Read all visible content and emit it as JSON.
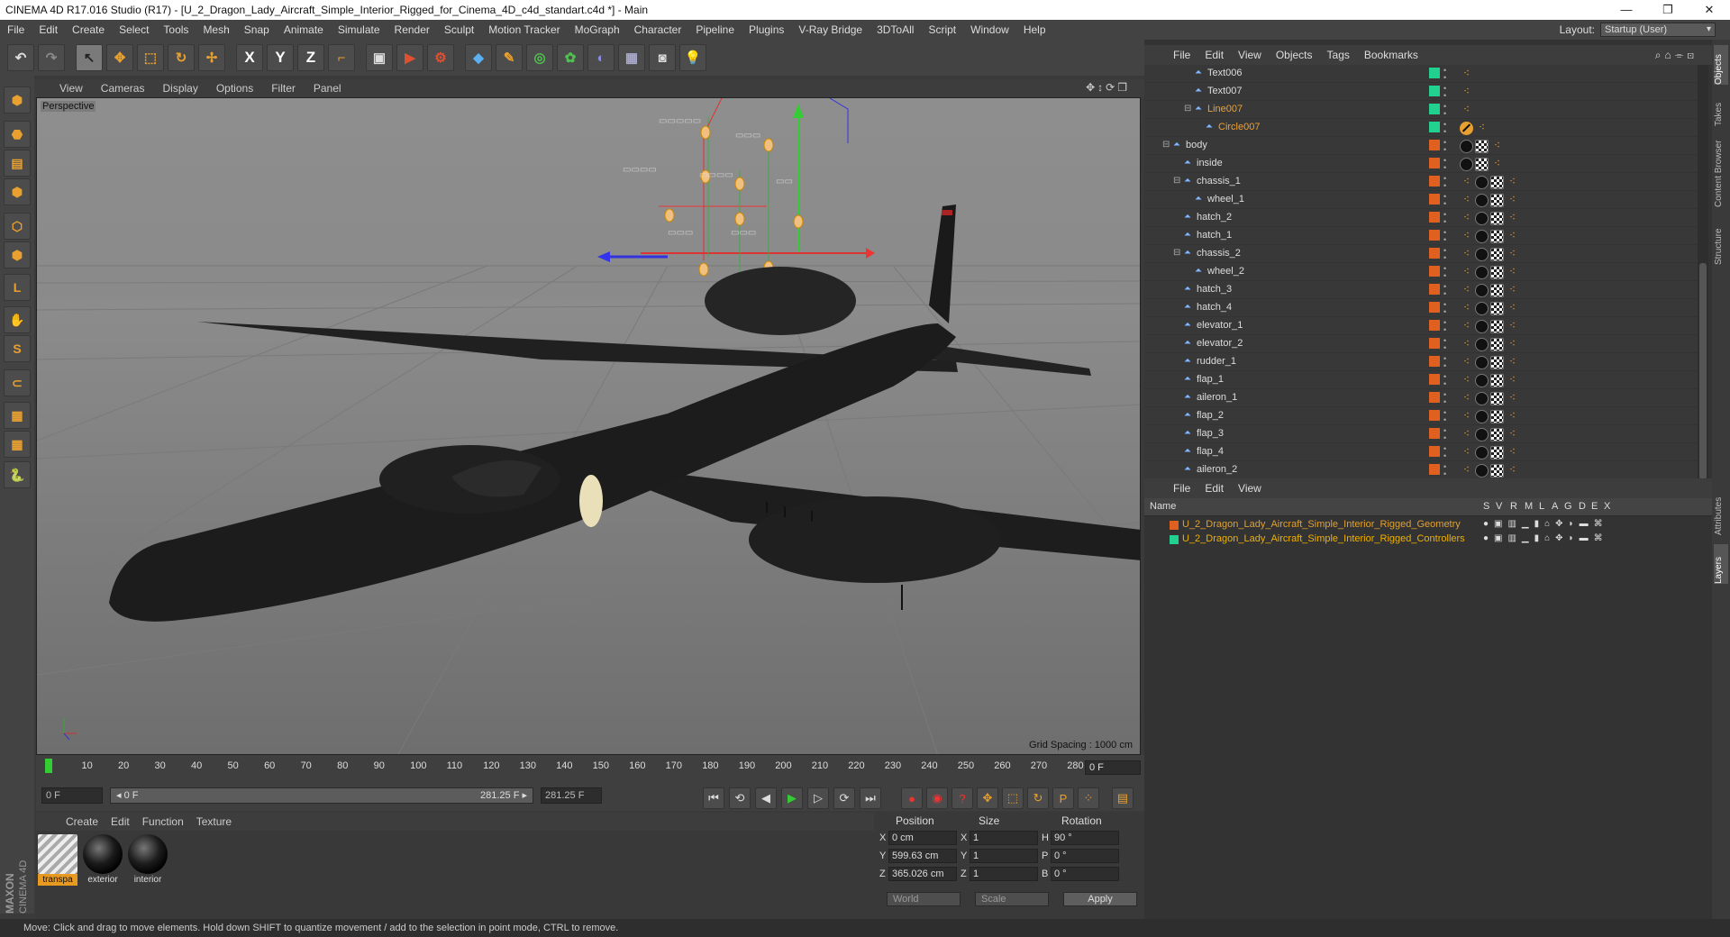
{
  "window": {
    "title": "CINEMA 4D R17.016 Studio (R17) - [U_2_Dragon_Lady_Aircraft_Simple_Interior_Rigged_for_Cinema_4D_c4d_standart.c4d *] - Main",
    "minimize": "—",
    "restore": "❐",
    "close": "✕"
  },
  "menu": [
    "File",
    "Edit",
    "Create",
    "Select",
    "Tools",
    "Mesh",
    "Snap",
    "Animate",
    "Simulate",
    "Render",
    "Sculpt",
    "Motion Tracker",
    "MoGraph",
    "Character",
    "Pipeline",
    "Plugins",
    "V-Ray Bridge",
    "3DToAll",
    "Script",
    "Window",
    "Help"
  ],
  "layout": {
    "label": "Layout:",
    "value": "Startup (User)"
  },
  "toolbar": {
    "undo": "↶",
    "redo": "↷",
    "pointer": "↖",
    "move": "✥",
    "scale": "⬚",
    "rotate": "↻",
    "transform": "✢",
    "x_axis": "X",
    "y_axis": "Y",
    "z_axis": "Z",
    "coord": "⌐",
    "render_view": "▣",
    "render_pv": "▶",
    "render_settings": "⚙",
    "cube": "◆",
    "spline": "✎",
    "nurbs": "◎",
    "array": "✿",
    "deformer": "◐",
    "floor": "▦",
    "camera": "◙",
    "light": "💡"
  },
  "lefttools": [
    "⬢",
    "⬣",
    "▤",
    "⬢",
    "⬡",
    "⬢",
    "L",
    "✋",
    "S",
    "⊂",
    "▦",
    "▦",
    "🐍"
  ],
  "viewport": {
    "menu": [
      "View",
      "Cameras",
      "Display",
      "Options",
      "Filter",
      "Panel"
    ],
    "nav": "✥↕⟳❐",
    "label": "Perspective",
    "grid_spacing": "Grid Spacing : 1000 cm"
  },
  "timeline": {
    "ticks": [
      "0",
      "10",
      "20",
      "30",
      "40",
      "50",
      "60",
      "70",
      "80",
      "90",
      "100",
      "110",
      "120",
      "130",
      "140",
      "150",
      "160",
      "170",
      "180",
      "190",
      "200",
      "210",
      "220",
      "230",
      "240",
      "250",
      "260",
      "270",
      "280"
    ],
    "current_frame": "0 F",
    "start": "0 F",
    "range_start": "◂ 0 F",
    "range_end": "281.25 F ▸",
    "end": "281.25 F",
    "buttons": [
      "⏮",
      "⟲",
      "◀",
      "▶",
      "▷",
      "⟳",
      "⏭"
    ],
    "rec_buttons": [
      "●",
      "◉",
      "?",
      "✥",
      "⬚",
      "↻",
      "P",
      "⁘",
      "▤"
    ]
  },
  "materials": {
    "menu": [
      "Create",
      "Edit",
      "Function",
      "Texture"
    ],
    "items": [
      {
        "name": "transpa",
        "color": "#d8d8d8"
      },
      {
        "name": "exterior",
        "color": "#1a1a1a"
      },
      {
        "name": "interior",
        "color": "#1d1d1d"
      }
    ]
  },
  "coords": {
    "headers": [
      "Position",
      "Size",
      "Rotation"
    ],
    "rows": [
      {
        "axis": "X",
        "pos": "0 cm",
        "sax": "X",
        "size": "1",
        "rax": "H",
        "rot": "90 °"
      },
      {
        "axis": "Y",
        "pos": "599.63 cm",
        "sax": "Y",
        "size": "1",
        "rax": "P",
        "rot": "0 °"
      },
      {
        "axis": "Z",
        "pos": "365.026 cm",
        "sax": "Z",
        "size": "1",
        "rax": "B",
        "rot": "0 °"
      }
    ],
    "mode": "World",
    "scale_mode": "Scale",
    "apply": "Apply"
  },
  "brand": {
    "line1": "MAXON",
    "line2": "CINEMA 4D"
  },
  "status": "Move: Click and drag to move elements. Hold down SHIFT to quantize movement / add to the selection in point mode, CTRL to remove.",
  "objects": {
    "menu": [
      "File",
      "Edit",
      "View",
      "Objects",
      "Tags",
      "Bookmarks"
    ],
    "icons": "⌕⌂⌯⊡",
    "rows": [
      {
        "name": "Text006",
        "indent": 3,
        "color": "#22d090",
        "orange": false,
        "tags": "dot"
      },
      {
        "name": "Text007",
        "indent": 3,
        "color": "#22d090",
        "orange": false,
        "tags": "dot"
      },
      {
        "name": "Line007",
        "indent": 3,
        "color": "#22d090",
        "orange": true,
        "tags": "dot",
        "expand": "⊟"
      },
      {
        "name": "Circle007",
        "indent": 4,
        "color": "#22d090",
        "orange": true,
        "tags": "forbid"
      },
      {
        "name": "body",
        "indent": 1,
        "color": "#e06020",
        "orange": false,
        "tags": "body",
        "expand": "⊟"
      },
      {
        "name": "inside",
        "indent": 2,
        "color": "#e06020",
        "orange": false,
        "tags": "body"
      },
      {
        "name": "chassis_1",
        "indent": 2,
        "color": "#e06020",
        "orange": false,
        "tags": "full",
        "expand": "⊟"
      },
      {
        "name": "wheel_1",
        "indent": 3,
        "color": "#e06020",
        "orange": false,
        "tags": "full"
      },
      {
        "name": "hatch_2",
        "indent": 2,
        "color": "#e06020",
        "orange": false,
        "tags": "full"
      },
      {
        "name": "hatch_1",
        "indent": 2,
        "color": "#e06020",
        "orange": false,
        "tags": "full"
      },
      {
        "name": "chassis_2",
        "indent": 2,
        "color": "#e06020",
        "orange": false,
        "tags": "full",
        "expand": "⊟"
      },
      {
        "name": "wheel_2",
        "indent": 3,
        "color": "#e06020",
        "orange": false,
        "tags": "full"
      },
      {
        "name": "hatch_3",
        "indent": 2,
        "color": "#e06020",
        "orange": false,
        "tags": "full"
      },
      {
        "name": "hatch_4",
        "indent": 2,
        "color": "#e06020",
        "orange": false,
        "tags": "full"
      },
      {
        "name": "elevator_1",
        "indent": 2,
        "color": "#e06020",
        "orange": false,
        "tags": "full"
      },
      {
        "name": "elevator_2",
        "indent": 2,
        "color": "#e06020",
        "orange": false,
        "tags": "full"
      },
      {
        "name": "rudder_1",
        "indent": 2,
        "color": "#e06020",
        "orange": false,
        "tags": "full"
      },
      {
        "name": "flap_1",
        "indent": 2,
        "color": "#e06020",
        "orange": false,
        "tags": "full"
      },
      {
        "name": "aileron_1",
        "indent": 2,
        "color": "#e06020",
        "orange": false,
        "tags": "full"
      },
      {
        "name": "flap_2",
        "indent": 2,
        "color": "#e06020",
        "orange": false,
        "tags": "full"
      },
      {
        "name": "flap_3",
        "indent": 2,
        "color": "#e06020",
        "orange": false,
        "tags": "full"
      },
      {
        "name": "flap_4",
        "indent": 2,
        "color": "#e06020",
        "orange": false,
        "tags": "full"
      },
      {
        "name": "aileron_2",
        "indent": 2,
        "color": "#e06020",
        "orange": false,
        "tags": "full"
      }
    ]
  },
  "layers": {
    "menu": [
      "File",
      "Edit",
      "View"
    ],
    "headers": [
      "Name",
      "S",
      "V",
      "R",
      "M",
      "L",
      "A",
      "G",
      "D",
      "E",
      "X"
    ],
    "rows": [
      {
        "name": "U_2_Dragon_Lady_Aircraft_Simple_Interior_Rigged_Geometry",
        "color": "#e06020",
        "text_color": "#e0a030"
      },
      {
        "name": "U_2_Dragon_Lady_Aircraft_Simple_Interior_Rigged_Controllers",
        "color": "#22d090",
        "text_color": "#f0b000"
      }
    ],
    "row_icons": "●▣▥▁▮⌂✥◗▬⌘"
  },
  "sidetabs": [
    "Objects",
    "Takes",
    "Content Browser",
    "Structure",
    "Attributes",
    "Layers"
  ]
}
